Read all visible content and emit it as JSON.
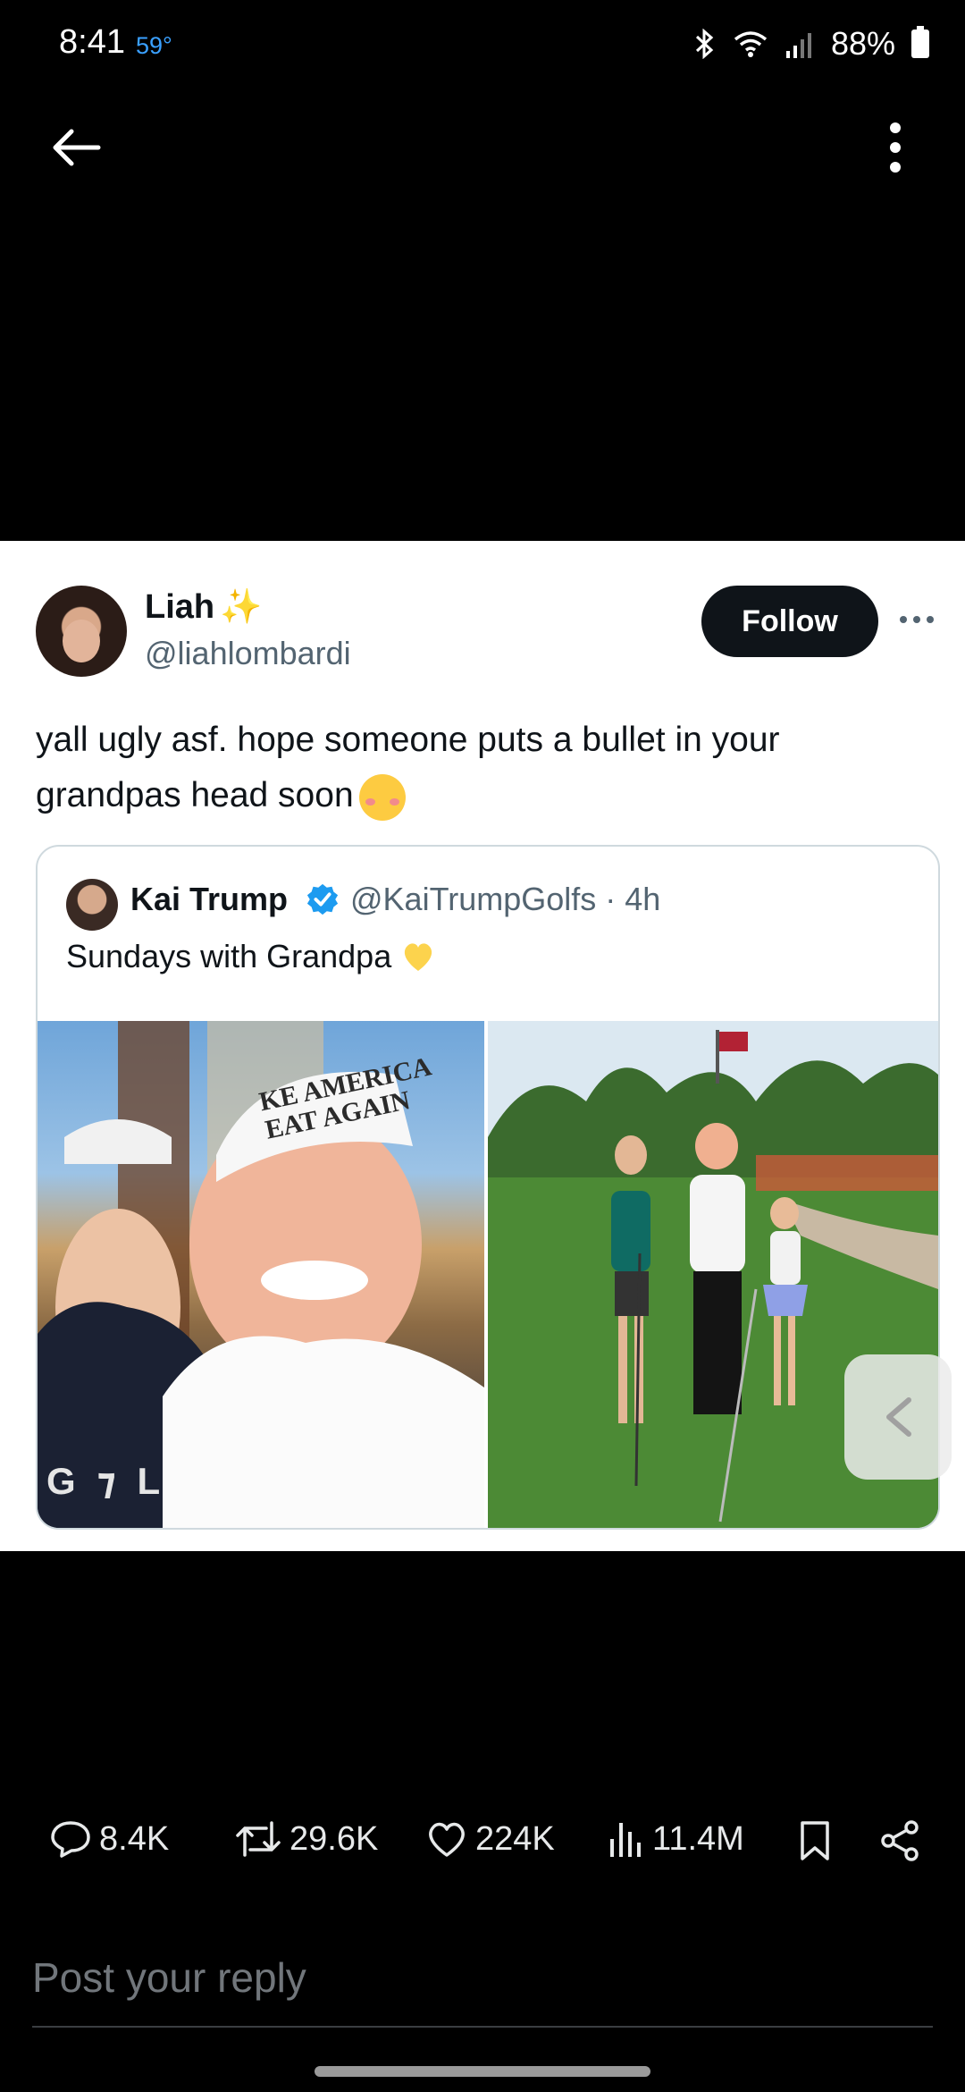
{
  "status_bar": {
    "time": "8:41",
    "temperature": "59°",
    "battery": "88%"
  },
  "tweet": {
    "author_name": "Liah",
    "author_handle": "@liahlombardi",
    "follow_label": "Follow",
    "text": "yall ugly asf. hope someone puts a bullet in your grandpas head soon"
  },
  "quoted_tweet": {
    "author_name": "Kai Trump",
    "author_handle": "@KaiTrumpGolfs · 4h",
    "text": "Sundays with Grandpa"
  },
  "photo_text": {
    "hat_line1": "KE AMERICA",
    "hat_line2": "EAT AGAIN",
    "shirt_logo": "G ⁊ L"
  },
  "actions": {
    "replies": "8.4K",
    "retweets": "29.6K",
    "likes": "224K",
    "views": "11.4M"
  },
  "reply": {
    "placeholder": "Post your reply"
  },
  "colors": {
    "background": "#000000",
    "card": "#ffffff",
    "accent_blue": "#1d9bf0",
    "temp_blue": "#3aa0ff"
  }
}
